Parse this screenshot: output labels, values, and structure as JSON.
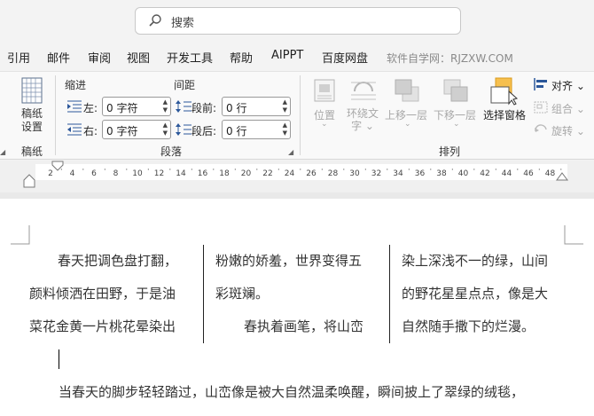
{
  "search": {
    "placeholder": "搜索"
  },
  "tabs": [
    {
      "label": "引用"
    },
    {
      "label": "邮件"
    },
    {
      "label": "审阅"
    },
    {
      "label": "视图"
    },
    {
      "label": "开发工具"
    },
    {
      "label": "帮助"
    },
    {
      "label": "AIPPT"
    },
    {
      "label": "百度网盘"
    }
  ],
  "watermark": "软件自学网：RJZXW.COM",
  "ribbon": {
    "manuscript": {
      "button": "稿纸\n设置",
      "button_l1": "稿纸",
      "button_l2": "设置",
      "group": "稿纸"
    },
    "paragraph": {
      "indent_header": "缩进",
      "spacing_header": "间距",
      "left_label": "左:",
      "right_label": "右:",
      "left_value": "0 字符",
      "right_value": "0 字符",
      "before_label": "段前:",
      "after_label": "段后:",
      "before_value": "0 行",
      "after_value": "0 行",
      "group": "段落"
    },
    "arrange": {
      "position": "位置",
      "wrap_l1": "环绕文",
      "wrap_l2": "字",
      "bring_forward": "上移一层",
      "send_backward": "下移一层",
      "selection_pane": "选择窗格",
      "align": "对齐",
      "group_btn": "组合",
      "rotate": "旋转",
      "group": "排列"
    }
  },
  "ruler": {
    "ticks": [
      "2",
      "4",
      "6",
      "8",
      "10",
      "12",
      "14",
      "16",
      "18",
      "20",
      "22",
      "24",
      "26",
      "28",
      "30",
      "32",
      "34",
      "36",
      "38",
      "40",
      "42",
      "44",
      "46",
      "48"
    ]
  },
  "document": {
    "col1": [
      "春天把调色盘打翻，",
      "颜料倾洒在田野，于是油",
      "菜花金黄一片桃花晕染出"
    ],
    "col2": [
      "粉嫩的娇羞，世界变得五",
      "彩斑斓。",
      "春执着画笔，将山峦"
    ],
    "col3": [
      "染上深浅不一的绿，山间",
      "的野花星星点点，像是大",
      "自然随手撒下的烂漫。"
    ],
    "para2": "当春天的脚步轻轻踏过，山峦像是被大自然温柔唤醒，瞬间披上了翠绿的绒毯，"
  },
  "colors": {
    "accent": "#2b579a",
    "selection_icon": "#f6c04f"
  }
}
